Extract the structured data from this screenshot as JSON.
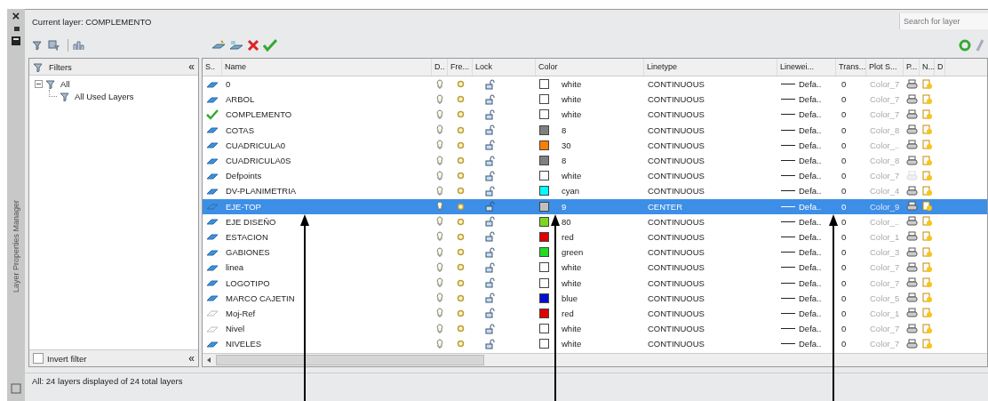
{
  "side_strip": {
    "close": "×",
    "title": "Layer Properties Manager"
  },
  "current_layer": "Current layer: COMPLEMENTO",
  "search": {
    "placeholder": "Search for layer"
  },
  "filters": {
    "header": "Filters",
    "collapse": "«",
    "tree": [
      {
        "label": "All",
        "expanded": true,
        "children": [
          {
            "label": "All Used Layers"
          }
        ]
      }
    ],
    "invert": {
      "label": "Invert filter",
      "checked": false
    },
    "collapse_bottom": "«"
  },
  "table": {
    "columns": [
      "S..",
      "Name",
      "D..",
      "Fre...",
      "Lock",
      "Color",
      "Linetype",
      "Linewei...",
      "Trans...",
      "Plot S...",
      "P...",
      "N...",
      "D"
    ],
    "rows": [
      {
        "current": false,
        "in_use": true,
        "name": "0",
        "color_name": "white",
        "color": "#ffffff",
        "linetype": "CONTINUOUS",
        "lineweight": "Defa..",
        "transparency": "0",
        "plot_style": "Color_7",
        "plot": true,
        "selected": false
      },
      {
        "current": false,
        "in_use": true,
        "name": "ARBOL",
        "color_name": "white",
        "color": "#ffffff",
        "linetype": "CONTINUOUS",
        "lineweight": "Defa..",
        "transparency": "0",
        "plot_style": "Color_7",
        "plot": true,
        "selected": false
      },
      {
        "current": true,
        "name": "COMPLEMENTO",
        "color_name": "white",
        "color": "#ffffff",
        "linetype": "CONTINUOUS",
        "lineweight": "Defa..",
        "transparency": "0",
        "plot_style": "Color_7",
        "plot": true,
        "selected": false
      },
      {
        "current": false,
        "in_use": true,
        "name": "COTAS",
        "color_name": "8",
        "color": "#808080",
        "linetype": "CONTINUOUS",
        "lineweight": "Defa..",
        "transparency": "0",
        "plot_style": "Color_8",
        "plot": true,
        "selected": false
      },
      {
        "current": false,
        "in_use": true,
        "name": "CUADRICULA0",
        "color_name": "30",
        "color": "#ff7f00",
        "linetype": "CONTINUOUS",
        "lineweight": "Defa..",
        "transparency": "0",
        "plot_style": "Color_..",
        "plot": true,
        "selected": false
      },
      {
        "current": false,
        "in_use": true,
        "name": "CUADRICULA0S",
        "color_name": "8",
        "color": "#808080",
        "linetype": "CONTINUOUS",
        "lineweight": "Defa..",
        "transparency": "0",
        "plot_style": "Color_8",
        "plot": true,
        "selected": false
      },
      {
        "current": false,
        "in_use": true,
        "name": "Defpoints",
        "color_name": "white",
        "color": "#ffffff",
        "linetype": "CONTINUOUS",
        "lineweight": "Defa..",
        "transparency": "0",
        "plot_style": "Color_7",
        "plot": false,
        "selected": false
      },
      {
        "current": false,
        "in_use": true,
        "name": "DV-PLANIMETRIA",
        "color_name": "cyan",
        "color": "#00ffff",
        "linetype": "CONTINUOUS",
        "lineweight": "Defa..",
        "transparency": "0",
        "plot_style": "Color_4",
        "plot": true,
        "selected": false
      },
      {
        "current": false,
        "in_use": true,
        "name": "EJE-TOP",
        "color_name": "9",
        "color": "#c0c0c0",
        "linetype": "CENTER",
        "lineweight": "Defa..",
        "transparency": "0",
        "plot_style": "Color_9",
        "plot": true,
        "selected": true
      },
      {
        "current": false,
        "in_use": true,
        "name": "EJE DISEÑO",
        "color_name": "80",
        "color": "#7fd61f",
        "linetype": "CONTINUOUS",
        "lineweight": "Defa..",
        "transparency": "0",
        "plot_style": "Color_..",
        "plot": true,
        "selected": false
      },
      {
        "current": false,
        "in_use": true,
        "name": "ESTACION",
        "color_name": "red",
        "color": "#e00000",
        "linetype": "CONTINUOUS",
        "lineweight": "Defa..",
        "transparency": "0",
        "plot_style": "Color_1",
        "plot": true,
        "selected": false
      },
      {
        "current": false,
        "in_use": true,
        "name": "GABIONES",
        "color_name": "green",
        "color": "#22dd22",
        "linetype": "CONTINUOUS",
        "lineweight": "Defa..",
        "transparency": "0",
        "plot_style": "Color_3",
        "plot": true,
        "selected": false
      },
      {
        "current": false,
        "in_use": true,
        "name": "linea",
        "color_name": "white",
        "color": "#ffffff",
        "linetype": "CONTINUOUS",
        "lineweight": "Defa..",
        "transparency": "0",
        "plot_style": "Color_7",
        "plot": true,
        "selected": false
      },
      {
        "current": false,
        "in_use": true,
        "name": "LOGOTIPO",
        "color_name": "white",
        "color": "#ffffff",
        "linetype": "CONTINUOUS",
        "lineweight": "Defa..",
        "transparency": "0",
        "plot_style": "Color_7",
        "plot": true,
        "selected": false
      },
      {
        "current": false,
        "in_use": true,
        "name": "MARCO CAJETIN",
        "color_name": "blue",
        "color": "#0010d0",
        "linetype": "CONTINUOUS",
        "lineweight": "Defa..",
        "transparency": "0",
        "plot_style": "Color_5",
        "plot": true,
        "selected": false
      },
      {
        "current": false,
        "in_use": false,
        "name": "Moj-Ref",
        "color_name": "red",
        "color": "#e00000",
        "linetype": "CONTINUOUS",
        "lineweight": "Defa..",
        "transparency": "0",
        "plot_style": "Color_1",
        "plot": true,
        "selected": false
      },
      {
        "current": false,
        "in_use": false,
        "name": "Nivel",
        "color_name": "white",
        "color": "#ffffff",
        "linetype": "CONTINUOUS",
        "lineweight": "Defa..",
        "transparency": "0",
        "plot_style": "Color_7",
        "plot": true,
        "selected": false
      },
      {
        "current": false,
        "in_use": true,
        "name": "NIVELES",
        "color_name": "white",
        "color": "#ffffff",
        "linetype": "CONTINUOUS",
        "lineweight": "Defa..",
        "transparency": "0",
        "plot_style": "Color_7",
        "plot": true,
        "selected": false
      }
    ]
  },
  "status_bar": "All: 24 layers displayed of 24 total layers"
}
